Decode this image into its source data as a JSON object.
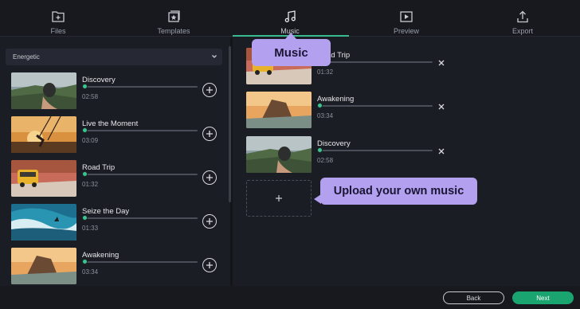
{
  "tabs": [
    {
      "label": "Files",
      "icon": "files-icon"
    },
    {
      "label": "Templates",
      "icon": "templates-icon"
    },
    {
      "label": "Music",
      "icon": "music-note-icon",
      "active": true
    },
    {
      "label": "Preview",
      "icon": "preview-icon"
    },
    {
      "label": "Export",
      "icon": "export-icon"
    }
  ],
  "library": {
    "filter_value": "Energetic",
    "tracks": [
      {
        "title": "Discovery",
        "duration": "02:58",
        "thumbnail": "hand-holding-compass"
      },
      {
        "title": "Live the Moment",
        "duration": "03:09",
        "thumbnail": "swing-at-sunset"
      },
      {
        "title": "Road Trip",
        "duration": "01:32",
        "thumbnail": "yellow-van"
      },
      {
        "title": "Seize the Day",
        "duration": "01:33",
        "thumbnail": "surfer-wave"
      },
      {
        "title": "Awakening",
        "duration": "03:34",
        "thumbnail": "sunrise-rocks"
      }
    ]
  },
  "selected": {
    "tracks": [
      {
        "title": "Road Trip",
        "duration": "01:32",
        "thumbnail": "yellow-van"
      },
      {
        "title": "Awakening",
        "duration": "03:34",
        "thumbnail": "sunrise-rocks"
      },
      {
        "title": "Discovery",
        "duration": "02:58",
        "thumbnail": "hand-holding-compass"
      }
    ]
  },
  "callouts": {
    "music": "Music",
    "upload": "Upload your own music"
  },
  "footer": {
    "back_label": "Back",
    "next_label": "Next"
  },
  "colors": {
    "accent": "#1aa46f",
    "callout": "#b3a1f0",
    "background": "#1b1d24"
  }
}
